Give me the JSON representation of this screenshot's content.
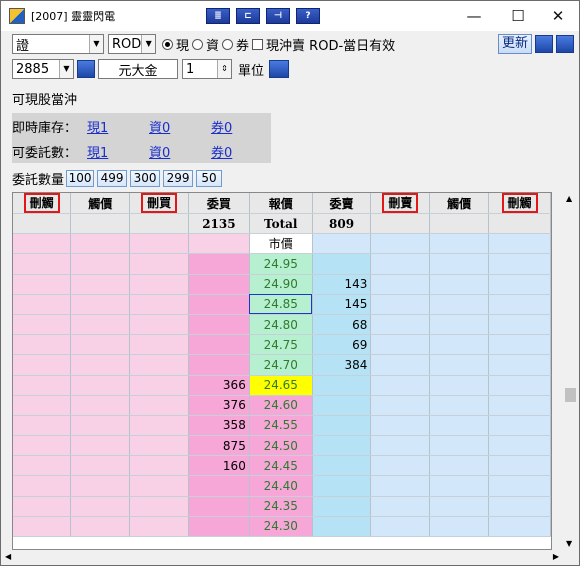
{
  "window": {
    "title": "[2007] 靈靈閃電",
    "min": "—",
    "max": "☐",
    "close": "✕"
  },
  "toolbar_icons": [
    {
      "name": "toolbar-icon-1",
      "glyph": "≣"
    },
    {
      "name": "toolbar-icon-2",
      "glyph": "⊏"
    },
    {
      "name": "toolbar-icon-3",
      "glyph": "⊣"
    },
    {
      "name": "help-icon",
      "glyph": "?"
    }
  ],
  "order": {
    "market": "證",
    "time_in_force": "ROD",
    "radio_cash": "現",
    "radio_margin": "資",
    "radio_short": "券",
    "daytrade_label": "現沖賣 ROD-當日有效",
    "refresh_label": "更新",
    "stock_code": "2885",
    "stock_name": "元大金",
    "quantity": "1",
    "unit_label": "單位"
  },
  "daytrade_status": "可現股當沖",
  "inventory": {
    "row1_label": "即時庫存：",
    "row1": [
      "現1",
      "資0",
      "券0"
    ],
    "row2_label": "可委託數：",
    "row2": [
      "現1",
      "資0",
      "券0"
    ]
  },
  "qty_label": "委託數量",
  "qty_buttons": [
    "100",
    "499",
    "300",
    "299",
    "50"
  ],
  "grid": {
    "headers": [
      "刪觸",
      "觸價",
      "刪買",
      "委買",
      "報價",
      "委賣",
      "刪賣",
      "觸價",
      "刪觸"
    ],
    "totals": {
      "buy": "2135",
      "label": "Total",
      "sell": "809"
    },
    "market_label": "市價",
    "rows": [
      {
        "price": "24.95",
        "buy": "",
        "sell": ""
      },
      {
        "price": "24.90",
        "buy": "",
        "sell": "143"
      },
      {
        "price": "24.85",
        "buy": "",
        "sell": "145"
      },
      {
        "price": "24.80",
        "buy": "",
        "sell": "68"
      },
      {
        "price": "24.75",
        "buy": "",
        "sell": "69"
      },
      {
        "price": "24.70",
        "buy": "",
        "sell": "384"
      },
      {
        "price": "24.65",
        "buy": "366",
        "sell": ""
      },
      {
        "price": "24.60",
        "buy": "376",
        "sell": ""
      },
      {
        "price": "24.55",
        "buy": "358",
        "sell": ""
      },
      {
        "price": "24.50",
        "buy": "875",
        "sell": ""
      },
      {
        "price": "24.45",
        "buy": "160",
        "sell": ""
      },
      {
        "price": "24.40",
        "buy": "",
        "sell": ""
      },
      {
        "price": "24.35",
        "buy": "",
        "sell": ""
      },
      {
        "price": "24.30",
        "buy": "",
        "sell": ""
      }
    ]
  },
  "colors": {
    "buy_col": "#f7a6d8",
    "sell_side": "#d2e8fa",
    "last_trade": "#ffff00",
    "price_text": "#2f7a2f"
  }
}
